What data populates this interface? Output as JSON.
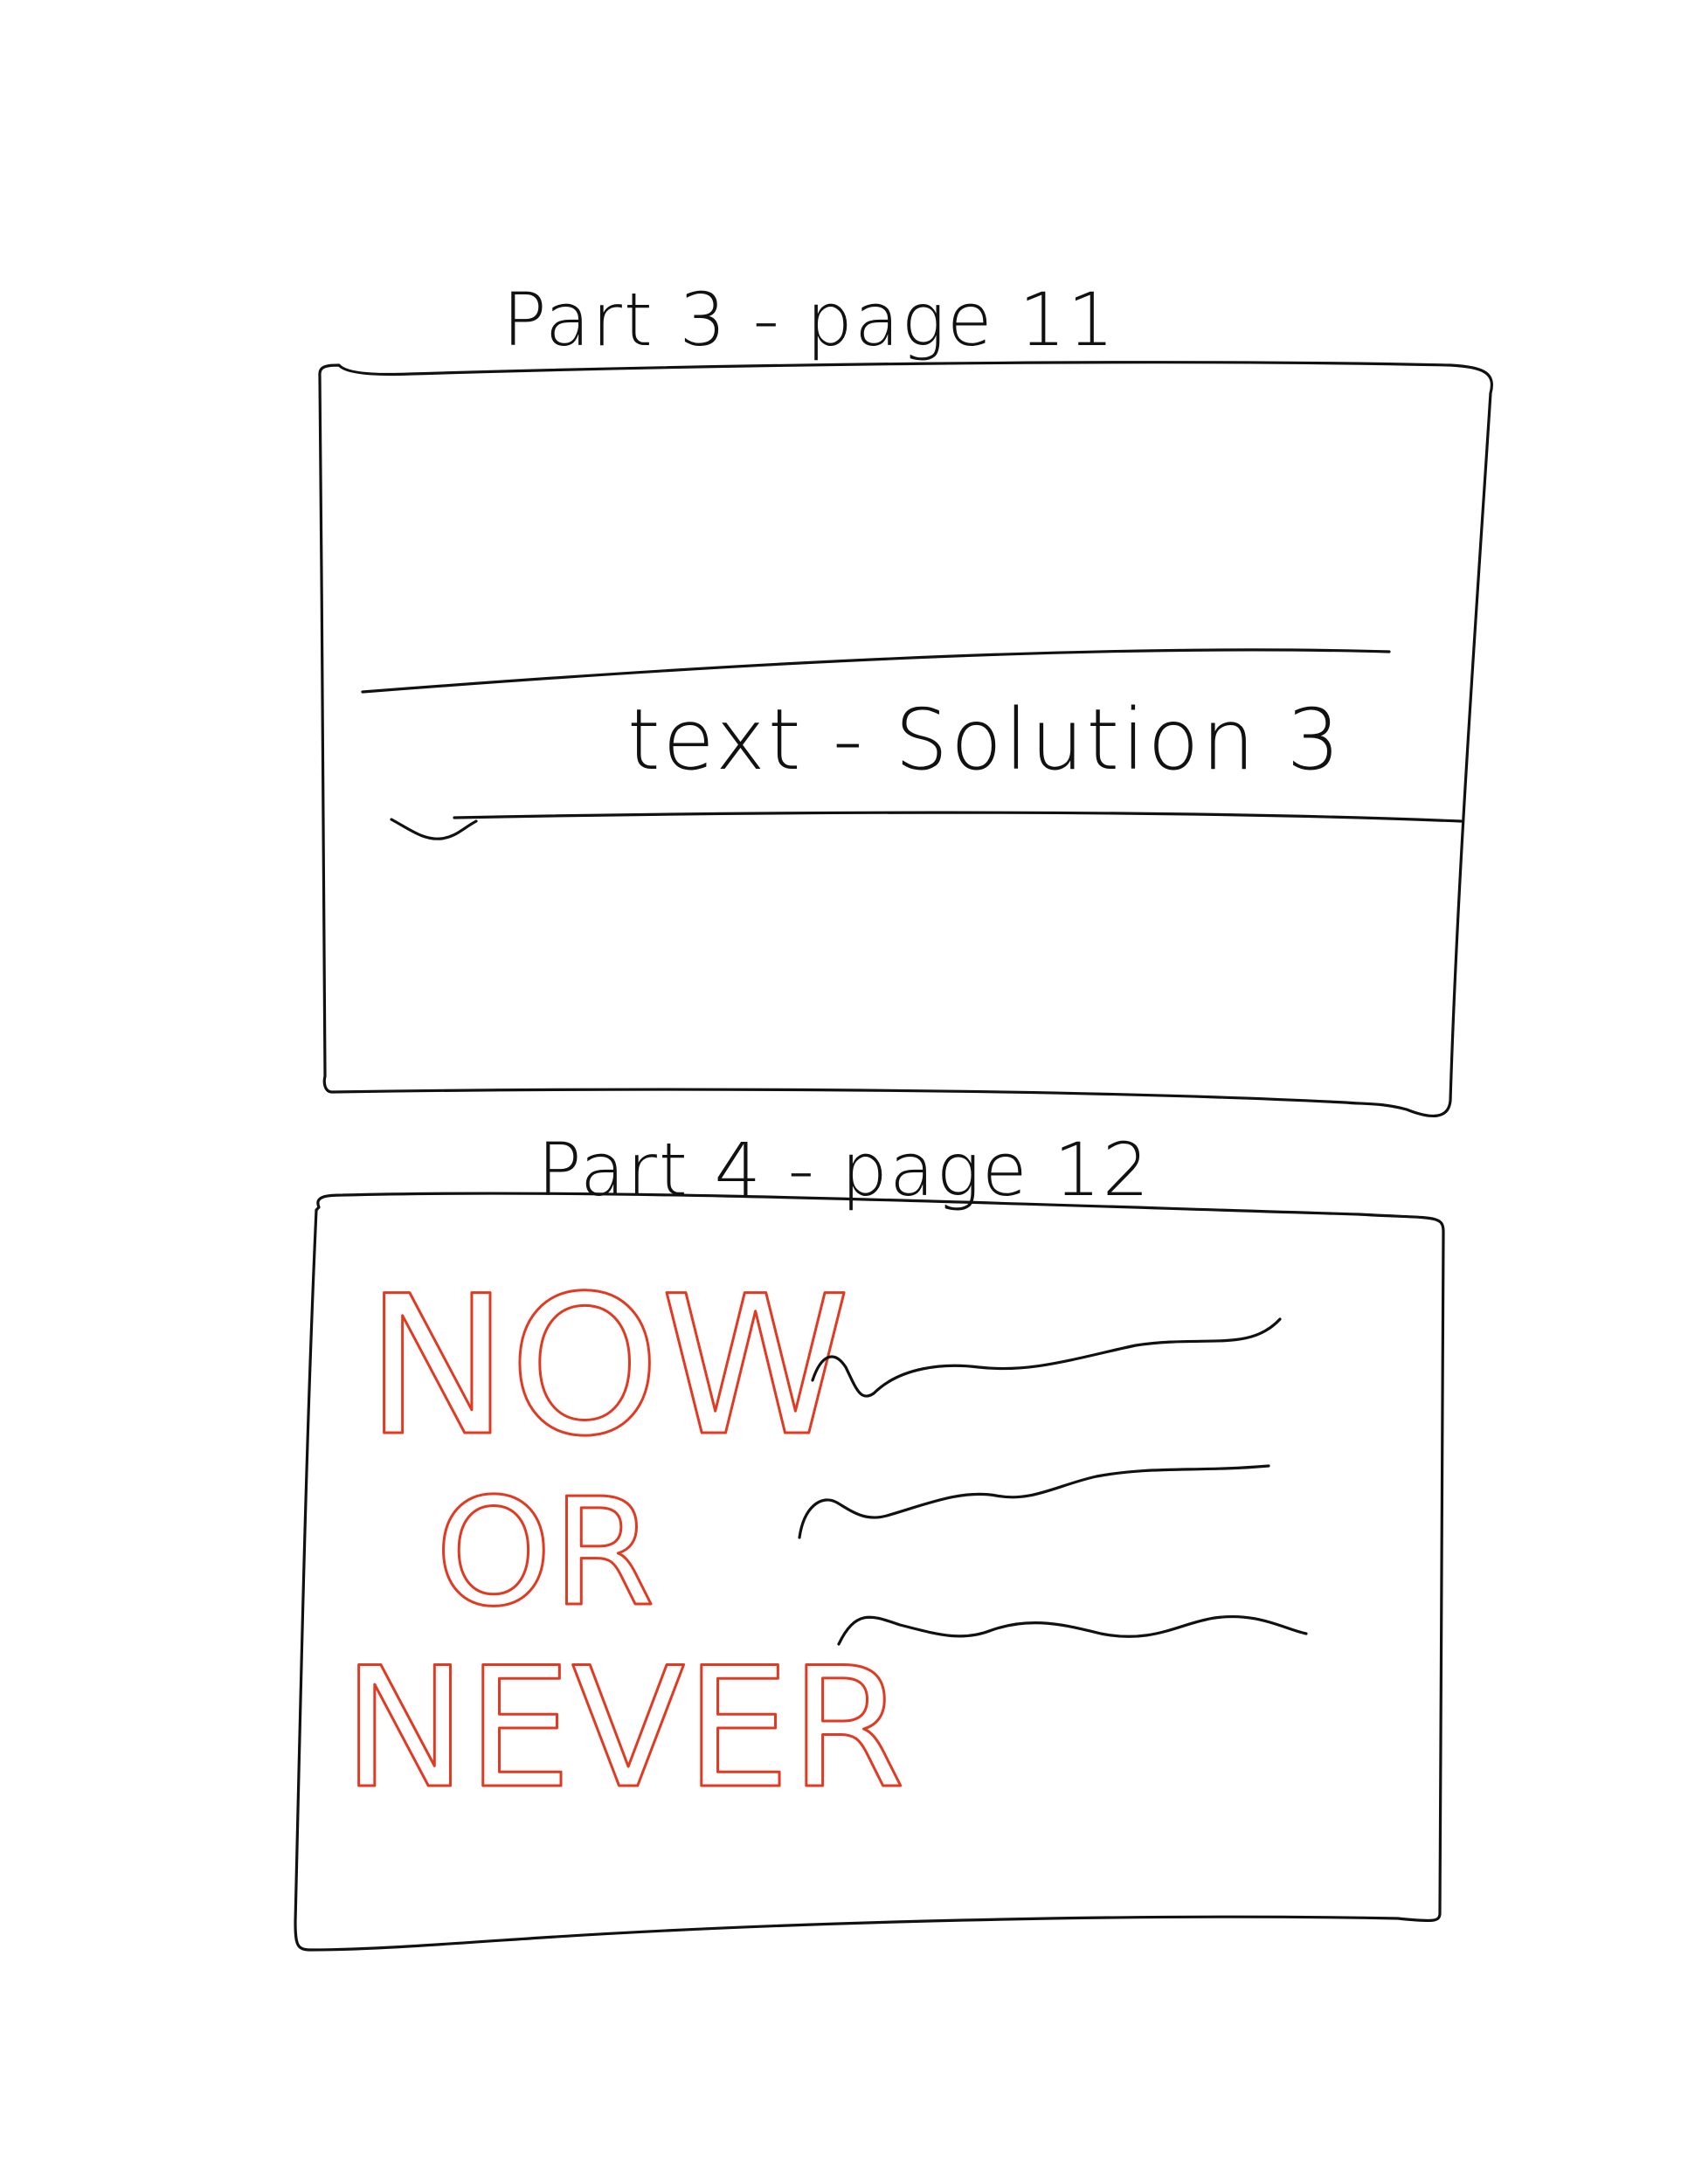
{
  "sections": [
    {
      "label": "Part 3 - page 11",
      "text_band": "text - Solution 3"
    },
    {
      "label": "Part 4 - page 12",
      "headline": [
        "NOW",
        "OR",
        "NEVER"
      ],
      "placeholder_lines": 3
    }
  ],
  "colors": {
    "ink": "#111111",
    "accent": "#e03a22"
  }
}
